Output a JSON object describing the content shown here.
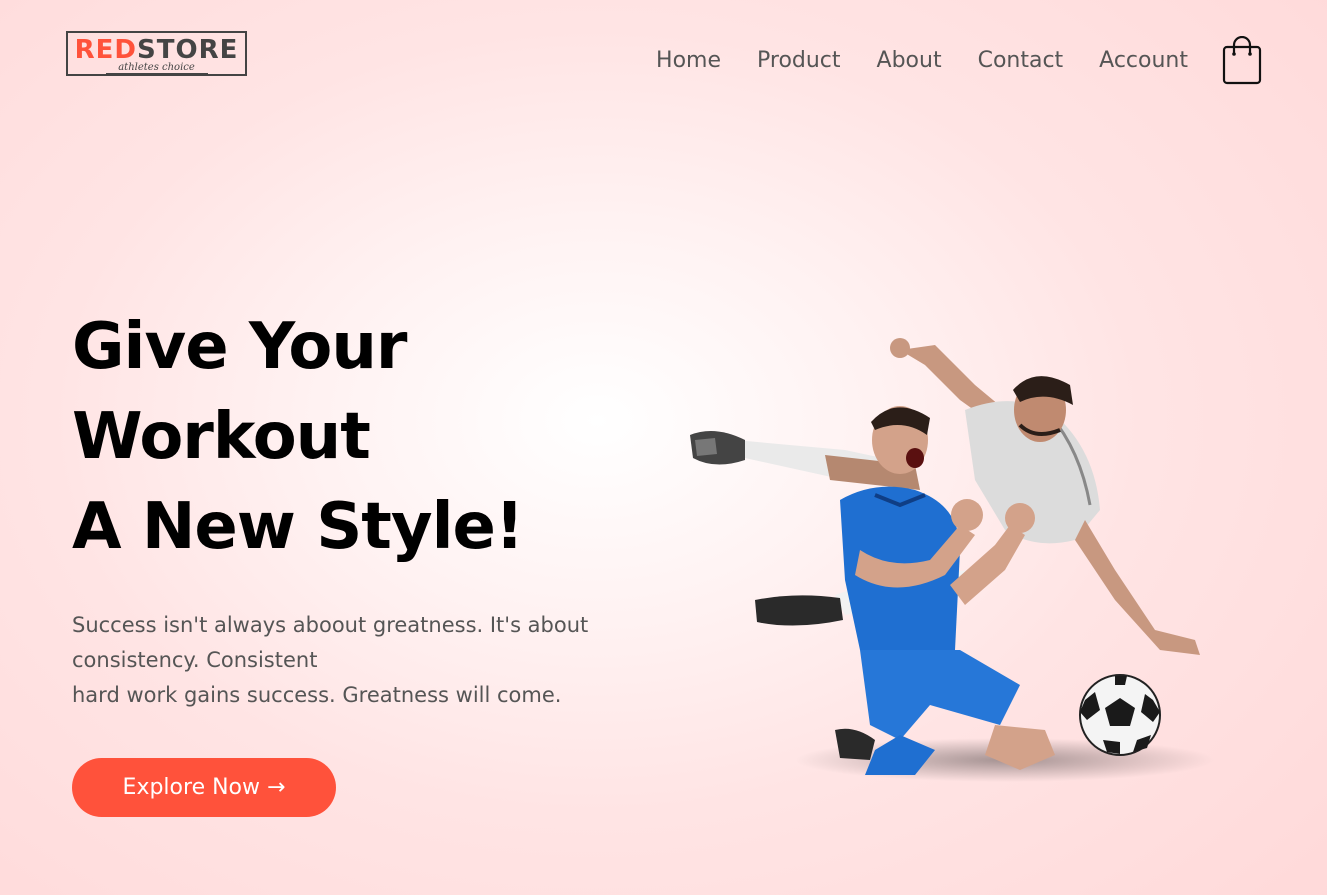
{
  "brand": {
    "logo_red": "RED",
    "logo_dark": "STORE",
    "logo_tagline": "athletes choice",
    "accent_color": "#ff523b"
  },
  "nav": {
    "items": [
      {
        "label": "Home"
      },
      {
        "label": "Product"
      },
      {
        "label": "About"
      },
      {
        "label": "Contact"
      },
      {
        "label": "Account"
      }
    ],
    "cart_icon": "shopping-bag-icon"
  },
  "hero": {
    "headline_lines": [
      "Give Your",
      "Workout",
      "A New Style!"
    ],
    "tagline_lines": [
      "Success isn't always aboout greatness. It's about",
      "consistency. Consistent",
      "hard work gains success. Greatness will come."
    ],
    "cta_label": "Explore Now →",
    "image": "soccer-players-image"
  }
}
